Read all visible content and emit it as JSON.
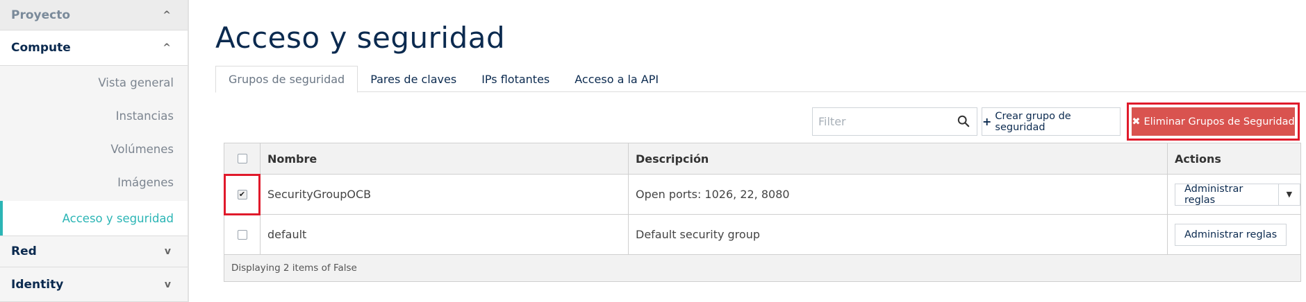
{
  "sidebar": {
    "proyecto": "Proyecto",
    "compute": "Compute",
    "items": [
      {
        "label": "Vista general"
      },
      {
        "label": "Instancias"
      },
      {
        "label": "Volúmenes"
      },
      {
        "label": "Imágenes"
      },
      {
        "label": "Acceso y seguridad",
        "active": true
      }
    ],
    "red": "Red",
    "identity": "Identity",
    "chevron_up": "^",
    "chevron_down": "v"
  },
  "page": {
    "title": "Acceso y seguridad"
  },
  "tabs": [
    {
      "label": "Grupos de seguridad",
      "active": true
    },
    {
      "label": "Pares de claves"
    },
    {
      "label": "IPs flotantes"
    },
    {
      "label": "Acceso a la API"
    }
  ],
  "toolbar": {
    "filter_placeholder": "Filter",
    "create_label": "Crear grupo de seguridad",
    "create_icon": "+",
    "delete_label": "Eliminar Grupos de Seguridad",
    "delete_icon": "✖"
  },
  "table": {
    "columns": [
      "Nombre",
      "Descripción",
      "Actions"
    ],
    "rows": [
      {
        "name": "SecurityGroupOCB",
        "description": "Open ports: 1026, 22, 8080",
        "action": "Administrar reglas",
        "checked": true
      },
      {
        "name": "default",
        "description": "Default security group",
        "action": "Administrar reglas",
        "checked": false
      }
    ],
    "footer": "Displaying 2 items of False",
    "caret": "▼",
    "check_mark": "✔"
  },
  "colors": {
    "brand_navy": "#0b2a4f",
    "accent_teal": "#2bb5b5",
    "danger": "#d9534f",
    "highlight_red": "#e01a2b"
  }
}
